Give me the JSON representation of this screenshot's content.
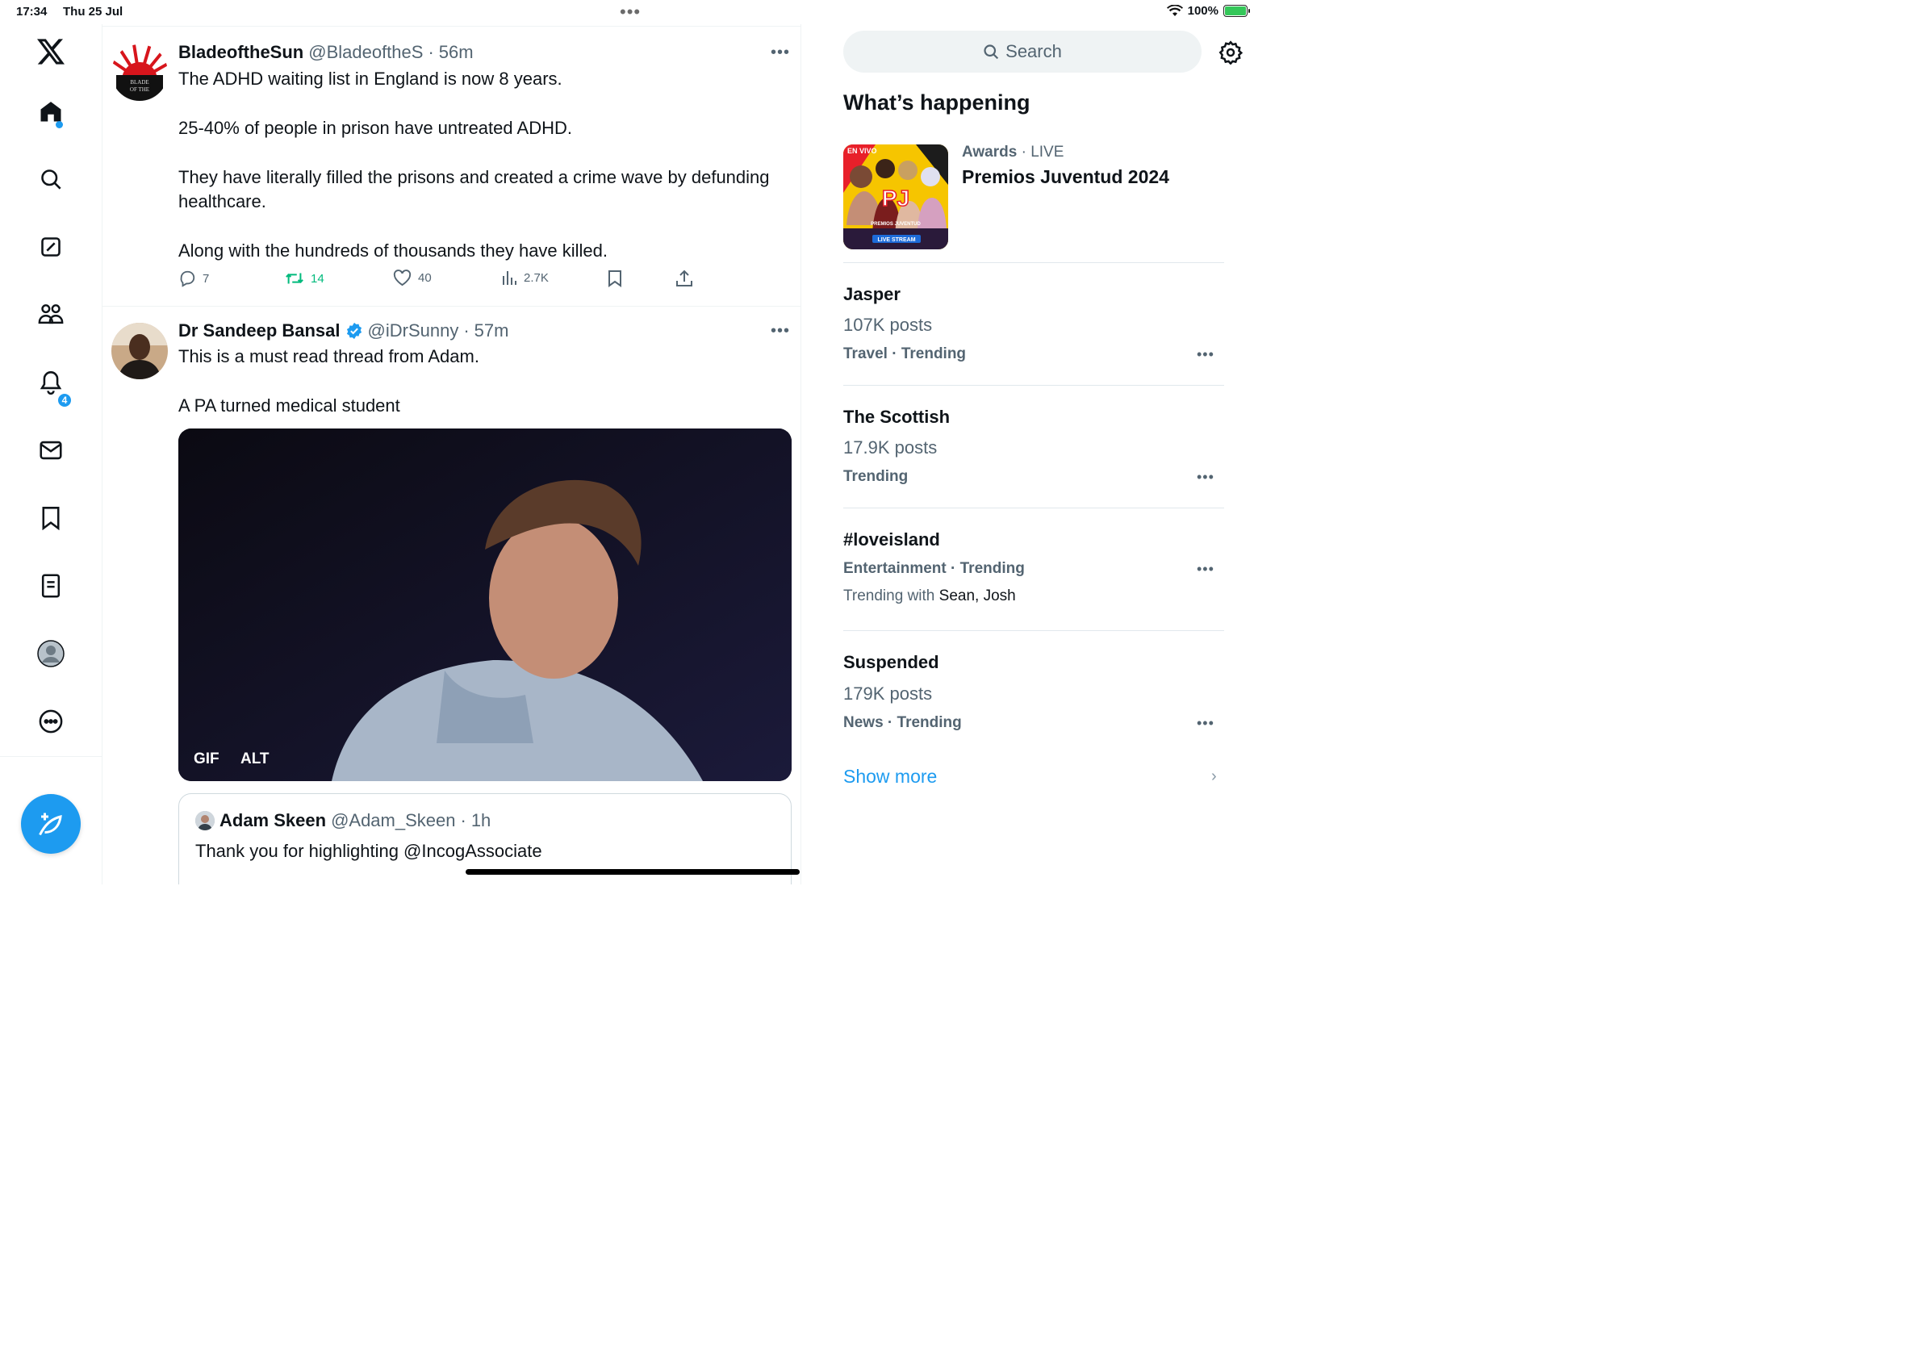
{
  "status_bar": {
    "time": "17:34",
    "date": "Thu 25 Jul",
    "battery": "100%"
  },
  "nav": {
    "notifications_badge": "4"
  },
  "tweets": [
    {
      "name": "BladeoftheSun",
      "handle": "@BladeoftheS",
      "time": "56m",
      "paragraphs": [
        "The ADHD waiting list in England is now 8 years.",
        "25-40% of people in prison have untreated ADHD.",
        "They have literally filled the prisons and created a crime wave by defunding healthcare.",
        "Along with the hundreds of thousands they have killed."
      ],
      "replies": "7",
      "retweets": "14",
      "likes": "40",
      "views": "2.7K"
    },
    {
      "name": "Dr Sandeep Bansal",
      "handle": "@iDrSunny",
      "time": "57m",
      "paragraphs": [
        "This is a must read thread from Adam.",
        "A PA turned medical student"
      ],
      "media_labels": [
        "GIF",
        "ALT"
      ],
      "quote": {
        "name": "Adam Skeen",
        "handle": "@Adam_Skeen",
        "time": "1h",
        "text": "Thank you for highlighting @IncogAssociate"
      }
    }
  ],
  "sidebar": {
    "search_placeholder": "Search",
    "title": "What’s happening",
    "featured": {
      "category": "Awards",
      "status": "LIVE",
      "title": "Premios Juventud 2024",
      "image_tag": "EN VIVO",
      "image_logo": "PJ",
      "image_caption": "PREMIOS JUVENTUD",
      "image_stream": "LIVE STREAM"
    },
    "trends": [
      {
        "title": "Jasper",
        "posts": "107K posts",
        "category": "Travel · Trending"
      },
      {
        "title": "The Scottish",
        "posts": "17.9K posts",
        "category": "Trending"
      },
      {
        "title": "#loveisland",
        "category": "Entertainment · Trending",
        "with_prefix": "Trending with",
        "with_names": "Sean, Josh"
      },
      {
        "title": "Suspended",
        "posts": "179K posts",
        "category": "News · Trending"
      }
    ],
    "show_more": "Show more"
  },
  "colors": {
    "accent": "#1d9bf0",
    "retweet": "#00ba7c",
    "muted": "#536471"
  }
}
